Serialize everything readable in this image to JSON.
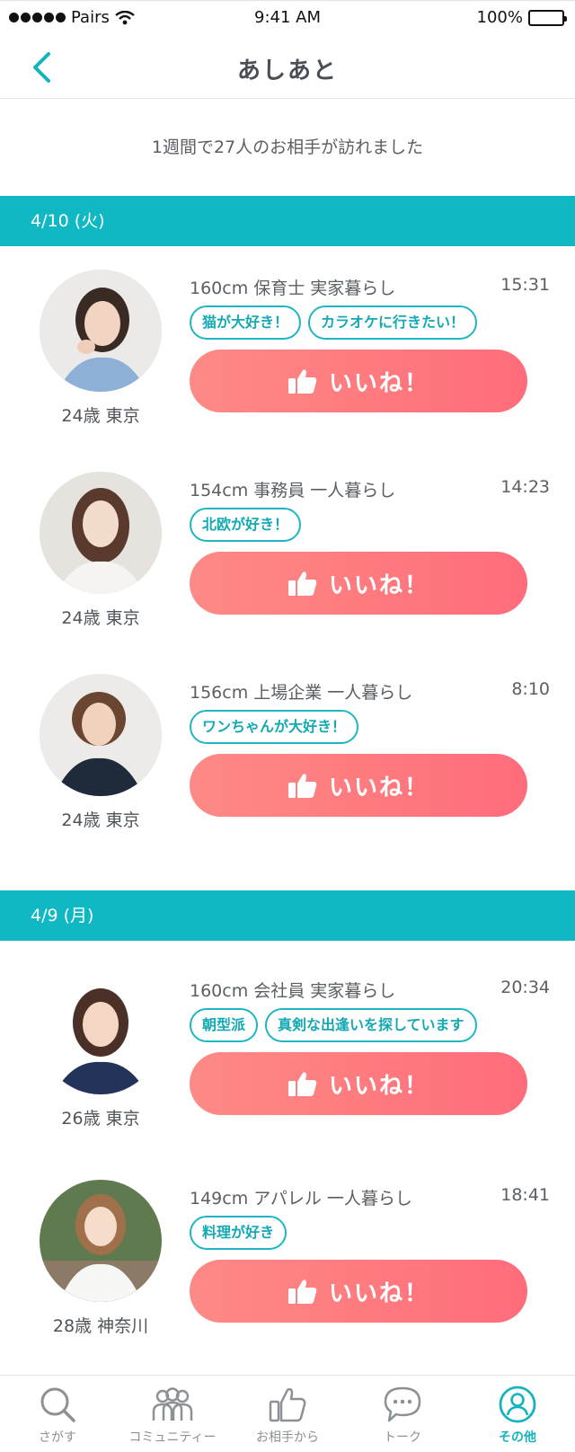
{
  "status_bar": {
    "carrier": "Pairs",
    "time": "9:41 AM",
    "battery": "100%"
  },
  "nav": {
    "title": "あしあと",
    "back_icon": "chevron-left-icon"
  },
  "summary": "1週間で27人のお相手が訪れました",
  "colors": {
    "accent": "#0fb8c3",
    "like_gradient_start": "#fd8a86",
    "like_gradient_end": "#ff6c7b",
    "tag_border": "#1fb6c1"
  },
  "like_label": "いいね！",
  "sections": [
    {
      "date": "4/10 (火)",
      "visitors": [
        {
          "age_location": "24歳 東京",
          "profile": "160cm 保育士 実家暮らし",
          "time": "15:31",
          "tags": [
            "猫が大好き！",
            "カラオケに行きたい！"
          ]
        },
        {
          "age_location": "24歳 東京",
          "profile": "154cm 事務員 一人暮らし",
          "time": "14:23",
          "tags": [
            "北欧が好き！"
          ]
        },
        {
          "age_location": "24歳 東京",
          "profile": "156cm 上場企業 一人暮らし",
          "time": "8:10",
          "tags": [
            "ワンちゃんが大好き！"
          ]
        }
      ]
    },
    {
      "date": "4/9 (月)",
      "visitors": [
        {
          "age_location": "26歳 東京",
          "profile": "160cm 会社員 実家暮らし",
          "time": "20:34",
          "tags": [
            "朝型派",
            "真剣な出逢いを探しています"
          ]
        },
        {
          "age_location": "28歳 神奈川",
          "profile": "149cm アパレル 一人暮らし",
          "time": "18:41",
          "tags": [
            "料理が好き"
          ]
        }
      ]
    }
  ],
  "tabbar": {
    "items": [
      {
        "label": "さがす",
        "icon": "search-icon"
      },
      {
        "label": "コミュニティー",
        "icon": "community-icon"
      },
      {
        "label": "お相手から",
        "icon": "thumbs-up-icon"
      },
      {
        "label": "トーク",
        "icon": "chat-bubble-icon"
      },
      {
        "label": "その他",
        "icon": "profile-icon",
        "active": true
      }
    ]
  }
}
